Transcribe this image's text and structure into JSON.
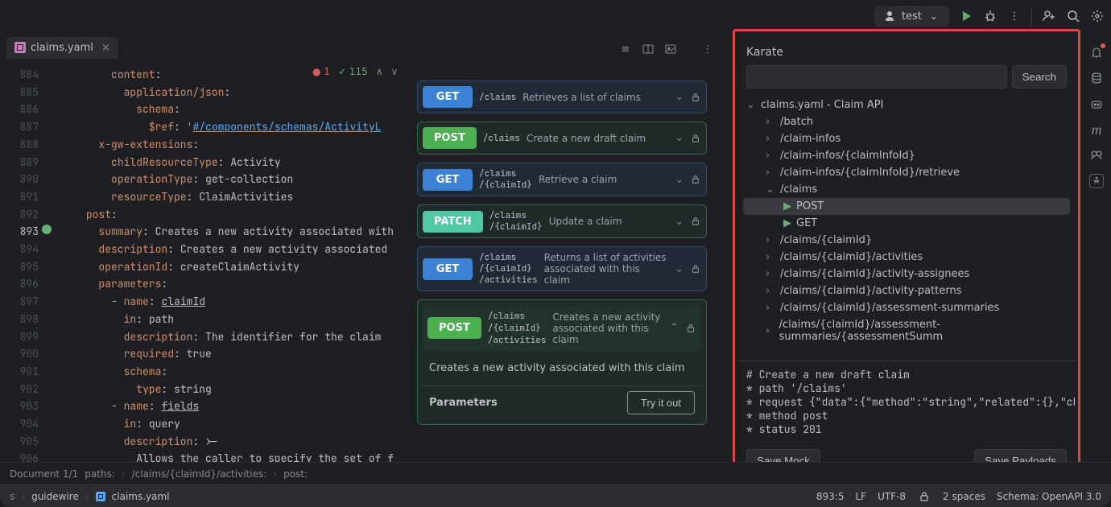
{
  "top": {
    "run_config": "test"
  },
  "tab": {
    "filename": "claims.yaml"
  },
  "inspection": {
    "error_count": "1",
    "ok_count": "115"
  },
  "lines": {
    "start": 884,
    "code": [
      {
        "indent": 10,
        "k": "content",
        "v": ":"
      },
      {
        "indent": 12,
        "k": "application/json",
        "v": ":"
      },
      {
        "indent": 14,
        "k": "schema",
        "v": ":"
      },
      {
        "indent": 16,
        "k": "$ref",
        "v": ": ",
        "s": "'",
        "link": "#/components/schemas/ActivityL"
      },
      {
        "indent": 8,
        "k": "x-gw-extensions",
        "v": ":"
      },
      {
        "indent": 10,
        "k": "childResourceType",
        "v": ": ",
        "val": "Activity"
      },
      {
        "indent": 10,
        "k": "operationType",
        "v": ": ",
        "val": "get-collection"
      },
      {
        "indent": 10,
        "k": "resourceType",
        "v": ": ",
        "val": "ClaimActivities"
      },
      {
        "indent": 6,
        "k": "post",
        "v": ":"
      },
      {
        "indent": 8,
        "k": "summary",
        "v": ": ",
        "val": "Creates a new activity associated with"
      },
      {
        "indent": 8,
        "k": "description",
        "v": ": ",
        "val": "Creates a new activity associated"
      },
      {
        "indent": 8,
        "k": "operationId",
        "v": ": ",
        "val": "createClaimActivity"
      },
      {
        "indent": 8,
        "k": "parameters",
        "v": ":"
      },
      {
        "indent": 10,
        "dash": true,
        "k": "name",
        "v": ": ",
        "link2": "claimId"
      },
      {
        "indent": 12,
        "k": "in",
        "v": ": ",
        "val": "path"
      },
      {
        "indent": 12,
        "k": "description",
        "v": ": ",
        "val": "The identifier for the claim"
      },
      {
        "indent": 12,
        "k": "required",
        "v": ": ",
        "val": "true"
      },
      {
        "indent": 12,
        "k": "schema",
        "v": ":"
      },
      {
        "indent": 14,
        "k": "type",
        "v": ": ",
        "val": "string"
      },
      {
        "indent": 10,
        "dash": true,
        "k": "name",
        "v": ": ",
        "link2": "fields"
      },
      {
        "indent": 12,
        "k": "in",
        "v": ": ",
        "val": "query"
      },
      {
        "indent": 12,
        "k": "description",
        "v": ": ",
        "val": ">-"
      },
      {
        "indent": 14,
        "plain": "Allows the caller to specify the set of f"
      }
    ]
  },
  "swagger": {
    "ops": [
      {
        "method": "GET",
        "cls": "get",
        "path": "/claims",
        "desc": "Retrieves a list of claims"
      },
      {
        "method": "POST",
        "cls": "post",
        "path": "/claims",
        "desc": "Create a new draft claim"
      },
      {
        "method": "GET",
        "cls": "get",
        "path": "/claims\n/{claimId}",
        "desc": "Retrieve a claim"
      },
      {
        "method": "PATCH",
        "cls": "patch",
        "path": "/claims\n/{claimId}",
        "desc": "Update a claim"
      },
      {
        "method": "GET",
        "cls": "get",
        "path": "/claims\n/{claimId}\n/activities",
        "desc": "Returns a list of activities associated with this claim"
      }
    ],
    "expanded": {
      "method": "POST",
      "path": "/claims\n/{claimId}\n/activities",
      "desc": "Creates a new activity associated with this claim",
      "body": "Creates a new activity associated with this claim",
      "params": "Parameters",
      "try": "Try it out"
    }
  },
  "karate": {
    "title": "Karate",
    "search_btn": "Search",
    "root": "claims.yaml - Claim API",
    "nodes": [
      {
        "label": "/batch",
        "lvl": 1
      },
      {
        "label": "/claim-infos",
        "lvl": 1
      },
      {
        "label": "/claim-infos/{claimInfoId}",
        "lvl": 1
      },
      {
        "label": "/claim-infos/{claimInfoId}/retrieve",
        "lvl": 1
      },
      {
        "label": "/claims",
        "lvl": 1,
        "open": true
      },
      {
        "label": "POST",
        "lvl": 2,
        "play": true,
        "sel": true
      },
      {
        "label": "GET",
        "lvl": 2,
        "play": true
      },
      {
        "label": "/claims/{claimId}",
        "lvl": 1
      },
      {
        "label": "/claims/{claimId}/activities",
        "lvl": 1
      },
      {
        "label": "/claims/{claimId}/activity-assignees",
        "lvl": 1
      },
      {
        "label": "/claims/{claimId}/activity-patterns",
        "lvl": 1
      },
      {
        "label": "/claims/{claimId}/assessment-summaries",
        "lvl": 1
      },
      {
        "label": "/claims/{claimId}/assessment-summaries/{assessmentSumm",
        "lvl": 1
      }
    ],
    "snippet": "# Create a new draft claim\n* path '/claims'\n* request {\"data\":{\"method\":\"string\",\"related\":{},\"che\n* method post\n* status 201",
    "save_mock": "Save Mock",
    "save_payloads": "Save Payloads"
  },
  "crumbs": {
    "doc": "Document 1/1",
    "path": "paths:",
    "claim": "/claims/{claimId}/activities:",
    "post": "post:"
  },
  "nav": {
    "proj": "guidewire",
    "file": "claims.yaml",
    "pos": "893:5",
    "lf": "LF",
    "enc": "UTF-8",
    "indent": "2 spaces",
    "schema": "Schema: OpenAPI 3.0"
  }
}
